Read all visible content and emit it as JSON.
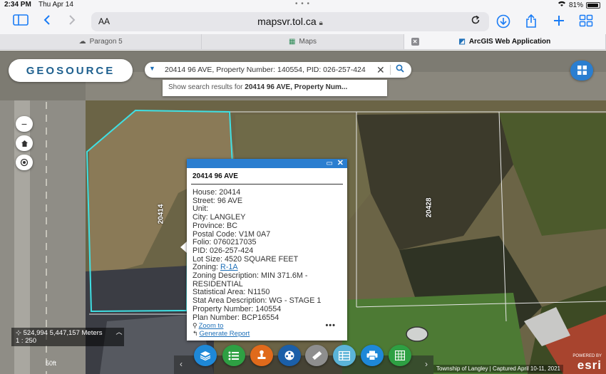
{
  "status_bar": {
    "time": "2:34 PM",
    "date": "Thu Apr 14",
    "battery": "81%",
    "battery_level": 0.81
  },
  "browser": {
    "text_size_label": "AA",
    "url": "mapsvr.tol.ca",
    "tabs": [
      {
        "label": "Paragon 5",
        "icon": "cloud-icon",
        "active": false
      },
      {
        "label": "Maps",
        "icon": "map-icon",
        "active": false
      },
      {
        "label": "ArcGIS Web Application",
        "icon": "arcgis-icon",
        "active": true
      }
    ]
  },
  "app": {
    "logo": "GEOSOURCE",
    "search": {
      "value": "20414 96 AVE, Property Number: 140554, PID: 026-257-424",
      "suggestion_prefix": "Show search results for ",
      "suggestion_bold": "20414 96 AVE, Property Num..."
    },
    "parcel_labels": {
      "left": "20414",
      "right": "20428"
    }
  },
  "popup": {
    "title": "20414 96 AVE",
    "fields": [
      {
        "label": "House:",
        "value": "20414"
      },
      {
        "label": "Street:",
        "value": "96 AVE"
      },
      {
        "label": "Unit:",
        "value": ""
      },
      {
        "label": "City:",
        "value": "LANGLEY"
      },
      {
        "label": "Province:",
        "value": "BC"
      },
      {
        "label": "Postal Code:",
        "value": "V1M 0A7"
      },
      {
        "label": "Folio:",
        "value": "0760217035"
      },
      {
        "label": "PID:",
        "value": "026-257-424"
      },
      {
        "label": "Lot Size:",
        "value": "4520 SQUARE FEET"
      }
    ],
    "zoning_label": "Zoning:",
    "zoning_link": "R-1A",
    "zoning_desc_line1": "Zoning Description: MIN 371.6M -",
    "zoning_desc_line2": "RESIDENTIAL",
    "fields_after": [
      {
        "label": "Statistical Area:",
        "value": "N1150"
      },
      {
        "label": "Stat Area Description:",
        "value": "WG - STAGE 1"
      },
      {
        "label": "Property Number:",
        "value": "140554"
      },
      {
        "label": "Plan Number:",
        "value": "BCP16554"
      }
    ],
    "zoom_to": "Zoom to",
    "generate_report": "Generate Report",
    "more": "•••"
  },
  "coordinates": {
    "xy": "524,994 5,447,157 Meters",
    "scale": "1 : 250"
  },
  "scalebar_label": "50ft",
  "attribution": "Township of Langley | Captured April 10-11, 2021",
  "esri": {
    "powered_by": "POWERED BY",
    "name": "esri"
  },
  "toolbar_tools": [
    {
      "name": "layers-tool",
      "icon": "layers-icon",
      "color": "#1e88d8"
    },
    {
      "name": "legend-tool",
      "icon": "list-icon",
      "color": "#2ea043"
    },
    {
      "name": "stamp-tool",
      "icon": "stamp-icon",
      "color": "#e06a1b"
    },
    {
      "name": "film-tool",
      "icon": "reel-icon",
      "color": "#1b5fa8"
    },
    {
      "name": "measure-tool",
      "icon": "ruler-icon",
      "color": "#8e8e8e"
    },
    {
      "name": "attribute-table-tool",
      "icon": "table-icon",
      "color": "#5bb4d8"
    },
    {
      "name": "print-tool",
      "icon": "printer-icon",
      "color": "#1e88d8"
    },
    {
      "name": "calculator-tool",
      "icon": "grid-icon",
      "color": "#2ea043"
    }
  ]
}
